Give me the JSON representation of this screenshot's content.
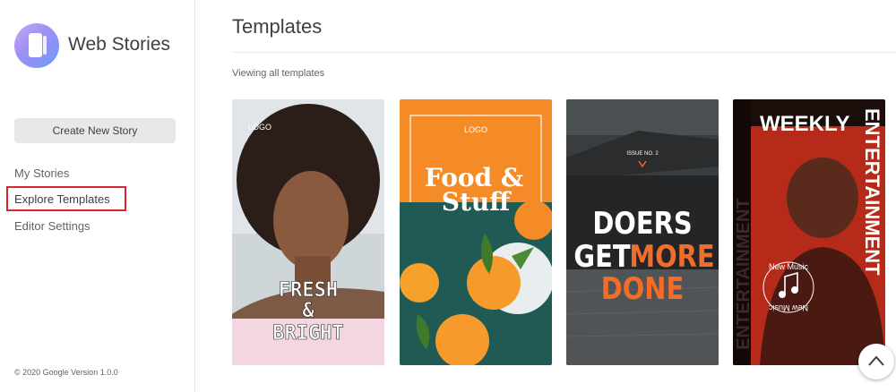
{
  "brand": {
    "name": "Web Stories"
  },
  "sidebar": {
    "create_label": "Create New Story",
    "items": [
      {
        "label": "My Stories"
      },
      {
        "label": "Explore Templates",
        "active": true
      },
      {
        "label": "Editor Settings"
      }
    ],
    "footer": "© 2020 Google Version 1.0.0"
  },
  "main": {
    "title": "Templates",
    "subtitle": "Viewing all templates"
  },
  "templates": [
    {
      "logo": "LOGO",
      "line1": "FRESH",
      "line2": "&",
      "line3": "BRIGHT"
    },
    {
      "logo": "LOGO",
      "line1": "Food &",
      "line2": "Stuff"
    },
    {
      "issue": "ISSUE NO. 2",
      "line1": "DOERS",
      "line2": "GET",
      "line3": "MORE",
      "line4": "DONE"
    },
    {
      "top": "WEEKLY",
      "side": "ENTERTAINMENT",
      "badge1": "New Music",
      "badge2": "New Music"
    }
  ],
  "colors": {
    "accent": "#d9262c",
    "orange": "#f58b27",
    "teal": "#1f5a55"
  },
  "icons": {
    "scroll_top": "chevron-up-icon"
  }
}
